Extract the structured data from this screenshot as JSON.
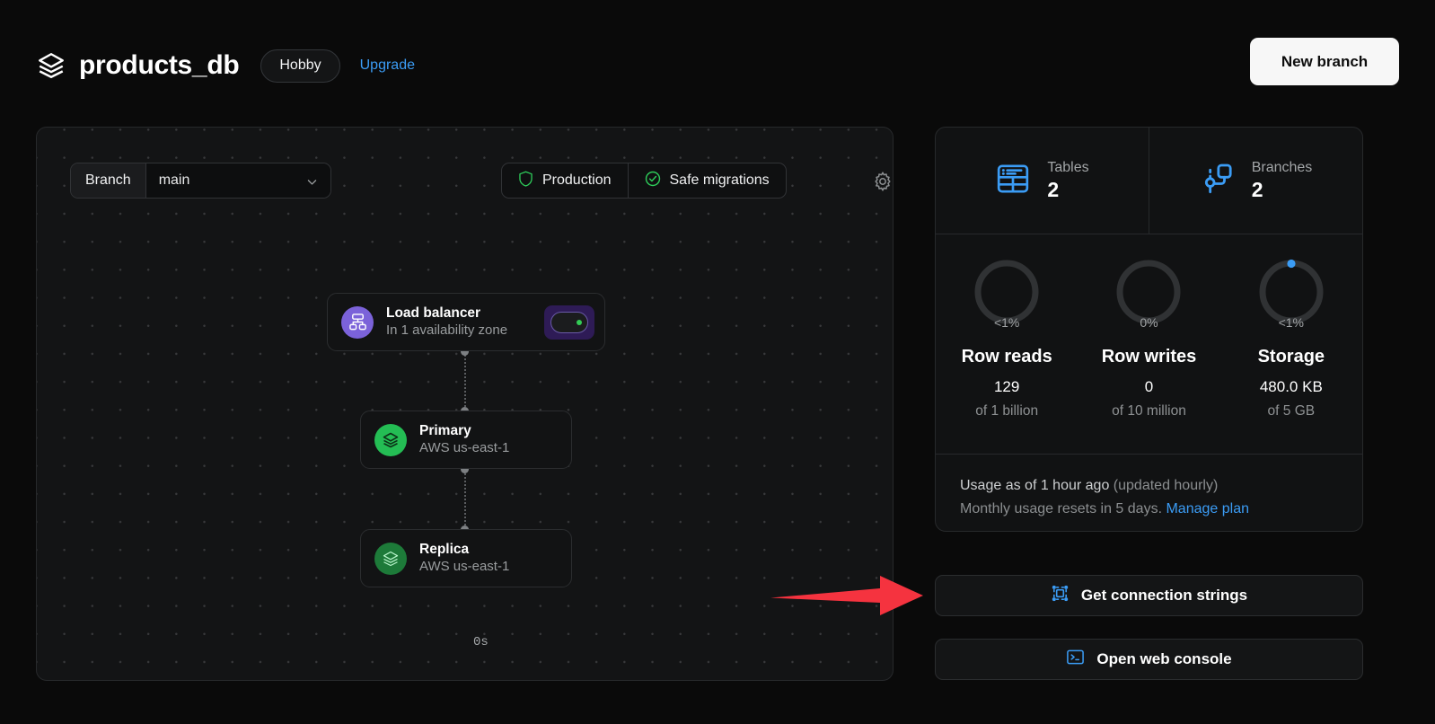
{
  "header": {
    "logo_icon": "layers-icon",
    "title": "products_db",
    "plan_badge": "Hobby",
    "upgrade_link": "Upgrade",
    "new_branch_label": "New branch"
  },
  "canvas": {
    "branch_label": "Branch",
    "branch_value": "main",
    "chevron_icon": "chevron-down-icon",
    "gear_icon": "gear-icon",
    "status": [
      {
        "icon": "shield-icon",
        "label": "Production",
        "color": "#2ecc5a"
      },
      {
        "icon": "check-circle-icon",
        "label": "Safe migrations",
        "color": "#2ecc5a"
      }
    ],
    "nodes": [
      {
        "icon": "network-topology-icon",
        "title": "Load balancer",
        "subtitle": "In 1 availability zone",
        "toggle_icon": "status-toggle-icon",
        "toggle_state_color": "#33cc55",
        "accent": "#7b62d9"
      },
      {
        "icon": "database-layers-icon",
        "title": "Primary",
        "subtitle": "AWS us-east-1",
        "accent": "#24bd54"
      },
      {
        "icon": "database-layers-icon",
        "title": "Replica",
        "subtitle": "AWS us-east-1",
        "accent": "#1d7a39"
      }
    ],
    "replication_lag": "0s"
  },
  "annotation": {
    "arrow_icon": "red-arrow-pointing-right",
    "color": "#f5333f"
  },
  "stats": {
    "counts": [
      {
        "icon": "table-icon",
        "label": "Tables",
        "value": "2"
      },
      {
        "icon": "branch-icon",
        "label": "Branches",
        "value": "2"
      }
    ],
    "usage": [
      {
        "percent": "<1%",
        "name": "Row reads",
        "value": "129",
        "limit": "of 1 billion",
        "ring_fill": 0
      },
      {
        "percent": "0%",
        "name": "Row writes",
        "value": "0",
        "limit": "of 10 million",
        "ring_fill": 0
      },
      {
        "percent": "<1%",
        "name": "Storage",
        "value": "480.0 KB",
        "limit": "of 5 GB",
        "ring_fill": 1,
        "marker_color": "#3b9cf5"
      }
    ],
    "note_primary": "Usage as of 1 hour ago",
    "note_primary_dim": "(updated hourly)",
    "note_secondary": "Monthly usage resets in 5 days.",
    "note_link": "Manage plan"
  },
  "actions": [
    {
      "icon": "connection-strings-icon",
      "label": "Get connection strings"
    },
    {
      "icon": "terminal-icon",
      "label": "Open web console"
    }
  ]
}
